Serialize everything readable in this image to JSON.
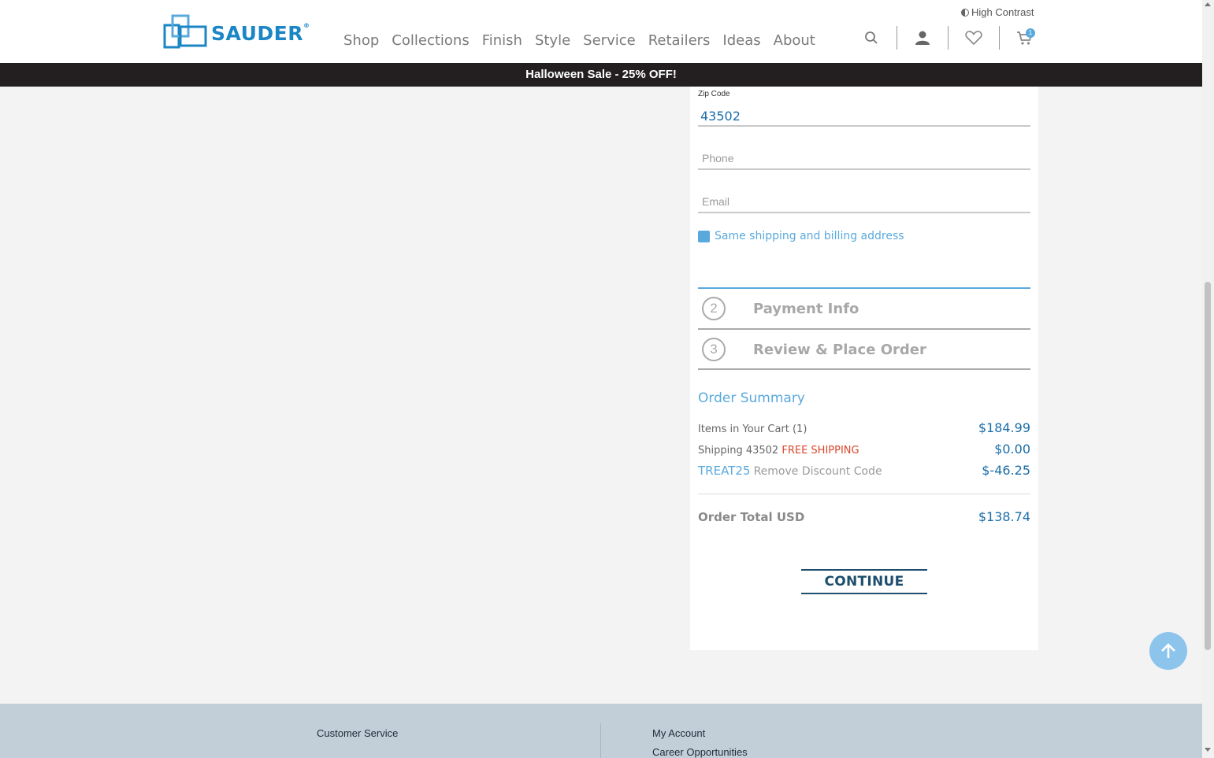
{
  "header": {
    "brand": "SAUDER",
    "brand_reg": "®",
    "high_contrast": "High Contrast",
    "nav": [
      "Shop",
      "Collections",
      "Finish",
      "Style",
      "Service",
      "Retailers",
      "Ideas",
      "About"
    ],
    "cart_count": "1"
  },
  "promo_banner": "Halloween Sale - 25% OFF!",
  "checkout": {
    "zip_label": "Zip Code",
    "zip_value": "43502",
    "phone_placeholder": "Phone",
    "email_placeholder": "Email",
    "same_address_label": "Same shipping and billing address",
    "steps": [
      {
        "num": "2",
        "title": "Payment Info"
      },
      {
        "num": "3",
        "title": "Review & Place Order"
      }
    ]
  },
  "summary": {
    "title": "Order Summary",
    "items_label": "Items in Your Cart (1)",
    "items_amount": "$184.99",
    "shipping_label": "Shipping 43502",
    "shipping_note": "FREE SHIPPING",
    "shipping_amount": "$0.00",
    "discount_code": "TREAT25",
    "remove_label": "Remove Discount Code",
    "discount_amount": "$-46.25",
    "total_label": "Order Total USD",
    "total_amount": "$138.74",
    "continue_label": "CONTINUE"
  },
  "footer": {
    "customer_service": "Customer Service",
    "my_account": "My Account",
    "career": "Career Opportunities"
  },
  "colors": {
    "brand_blue": "#1b86c6",
    "accent_light_blue": "#5aa9dc",
    "free_shipping_red": "#d9472b",
    "promo_bar": "#231f20"
  }
}
